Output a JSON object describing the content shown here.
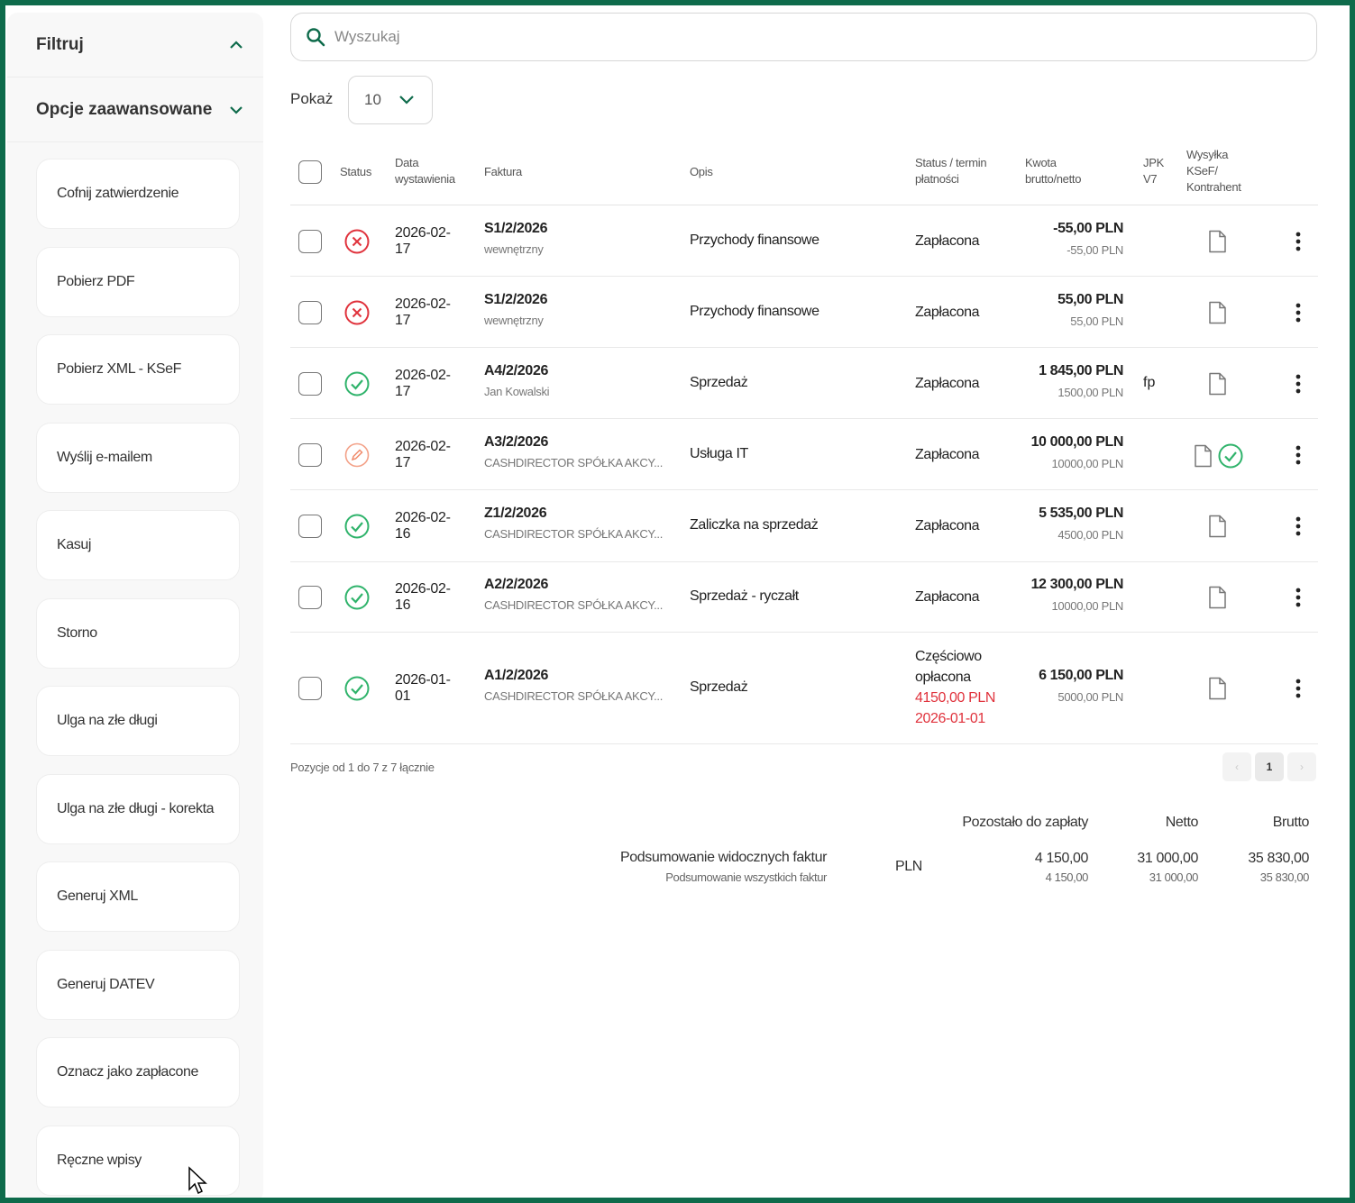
{
  "sidebar": {
    "filter_title": "Filtruj",
    "advanced_title": "Opcje zaawansowane",
    "buttons": [
      "Cofnij zatwierdzenie",
      "Pobierz PDF",
      "Pobierz XML - KSeF",
      "Wyślij e-mailem",
      "Kasuj",
      "Storno",
      "Ulga na złe długi",
      "Ulga na złe długi - korekta",
      "Generuj XML",
      "Generuj DATEV",
      "Oznacz jako zapłacone",
      "Ręczne wpisy"
    ]
  },
  "search": {
    "placeholder": "Wyszukaj"
  },
  "show": {
    "label": "Pokaż",
    "value": "10"
  },
  "table": {
    "headers": {
      "status": "Status",
      "date_1": "Data",
      "date_2": "wystawienia",
      "invoice": "Faktura",
      "desc": "Opis",
      "pay_1": "Status / termin",
      "pay_2": "płatności",
      "amount_1": "Kwota",
      "amount_2": "brutto/netto",
      "jpk_1": "JPK",
      "jpk_2": "V7",
      "ksef_1": "Wysyłka",
      "ksef_2": "KSeF/",
      "ksef_3": "Kontrahent"
    },
    "rows": [
      {
        "status": "error",
        "date_1": "2026-02-",
        "date_2": "17",
        "number": "S1/2/2026",
        "party": "wewnętrzny",
        "desc": "Przychody finansowe",
        "pay": "Zapłacona",
        "gross": "-55,00 PLN",
        "net": "-55,00 PLN",
        "jpk": "",
        "ksef_ok": false
      },
      {
        "status": "error",
        "date_1": "2026-02-",
        "date_2": "17",
        "number": "S1/2/2026",
        "party": "wewnętrzny",
        "desc": "Przychody finansowe",
        "pay": "Zapłacona",
        "gross": "55,00 PLN",
        "net": "55,00 PLN",
        "jpk": "",
        "ksef_ok": false
      },
      {
        "status": "ok",
        "date_1": "2026-02-",
        "date_2": "17",
        "number": "A4/2/2026",
        "party": "Jan Kowalski",
        "desc": "Sprzedaż",
        "pay": "Zapłacona",
        "gross": "1 845,00 PLN",
        "net": "1500,00 PLN",
        "jpk": "fp",
        "ksef_ok": false
      },
      {
        "status": "edit",
        "date_1": "2026-02-",
        "date_2": "17",
        "number": "A3/2/2026",
        "party": "CASHDIRECTOR SPÓŁKA AKCY...",
        "desc": "Usługa IT",
        "pay": "Zapłacona",
        "gross": "10 000,00 PLN",
        "net": "10000,00 PLN",
        "jpk": "",
        "ksef_ok": true
      },
      {
        "status": "ok",
        "date_1": "2026-02-",
        "date_2": "16",
        "number": "Z1/2/2026",
        "party": "CASHDIRECTOR SPÓŁKA AKCY...",
        "desc": "Zaliczka na sprzedaż",
        "pay": "Zapłacona",
        "gross": "5 535,00 PLN",
        "net": "4500,00 PLN",
        "jpk": "",
        "ksef_ok": false
      },
      {
        "status": "ok",
        "date_1": "2026-02-",
        "date_2": "16",
        "number": "A2/2/2026",
        "party": "CASHDIRECTOR SPÓŁKA AKCY...",
        "desc": "Sprzedaż - ryczałt",
        "pay": "Zapłacona",
        "gross": "12 300,00 PLN",
        "net": "10000,00 PLN",
        "jpk": "",
        "ksef_ok": false
      },
      {
        "status": "ok",
        "date_1": "2026-01-",
        "date_2": "01",
        "number": "A1/2/2026",
        "party": "CASHDIRECTOR SPÓŁKA AKCY...",
        "desc": "Sprzedaż",
        "pay_1": "Częściowo",
        "pay_2": "opłacona",
        "pay_amount": "4150,00 PLN",
        "pay_date": "2026-01-01",
        "gross": "6 150,00 PLN",
        "net": "5000,00 PLN",
        "jpk": "",
        "ksef_ok": false
      }
    ]
  },
  "pagination": {
    "info": "Pozycje od 1 do 7 z 7 łącznie",
    "page": "1"
  },
  "summary": {
    "col_remaining": "Pozostało do zapłaty",
    "col_net": "Netto",
    "col_gross": "Brutto",
    "label_visible": "Podsumowanie widocznych faktur",
    "label_all": "Podsumowanie wszystkich faktur",
    "currency": "PLN",
    "visible": {
      "remaining": "4 150,00",
      "net": "31 000,00",
      "gross": "35 830,00"
    },
    "all": {
      "remaining": "4 150,00",
      "net": "31 000,00",
      "gross": "35 830,00"
    }
  },
  "colors": {
    "brand": "#0e6b4b",
    "ok": "#2fb36b",
    "error": "#e0323c",
    "edit": "#f08a6a"
  }
}
